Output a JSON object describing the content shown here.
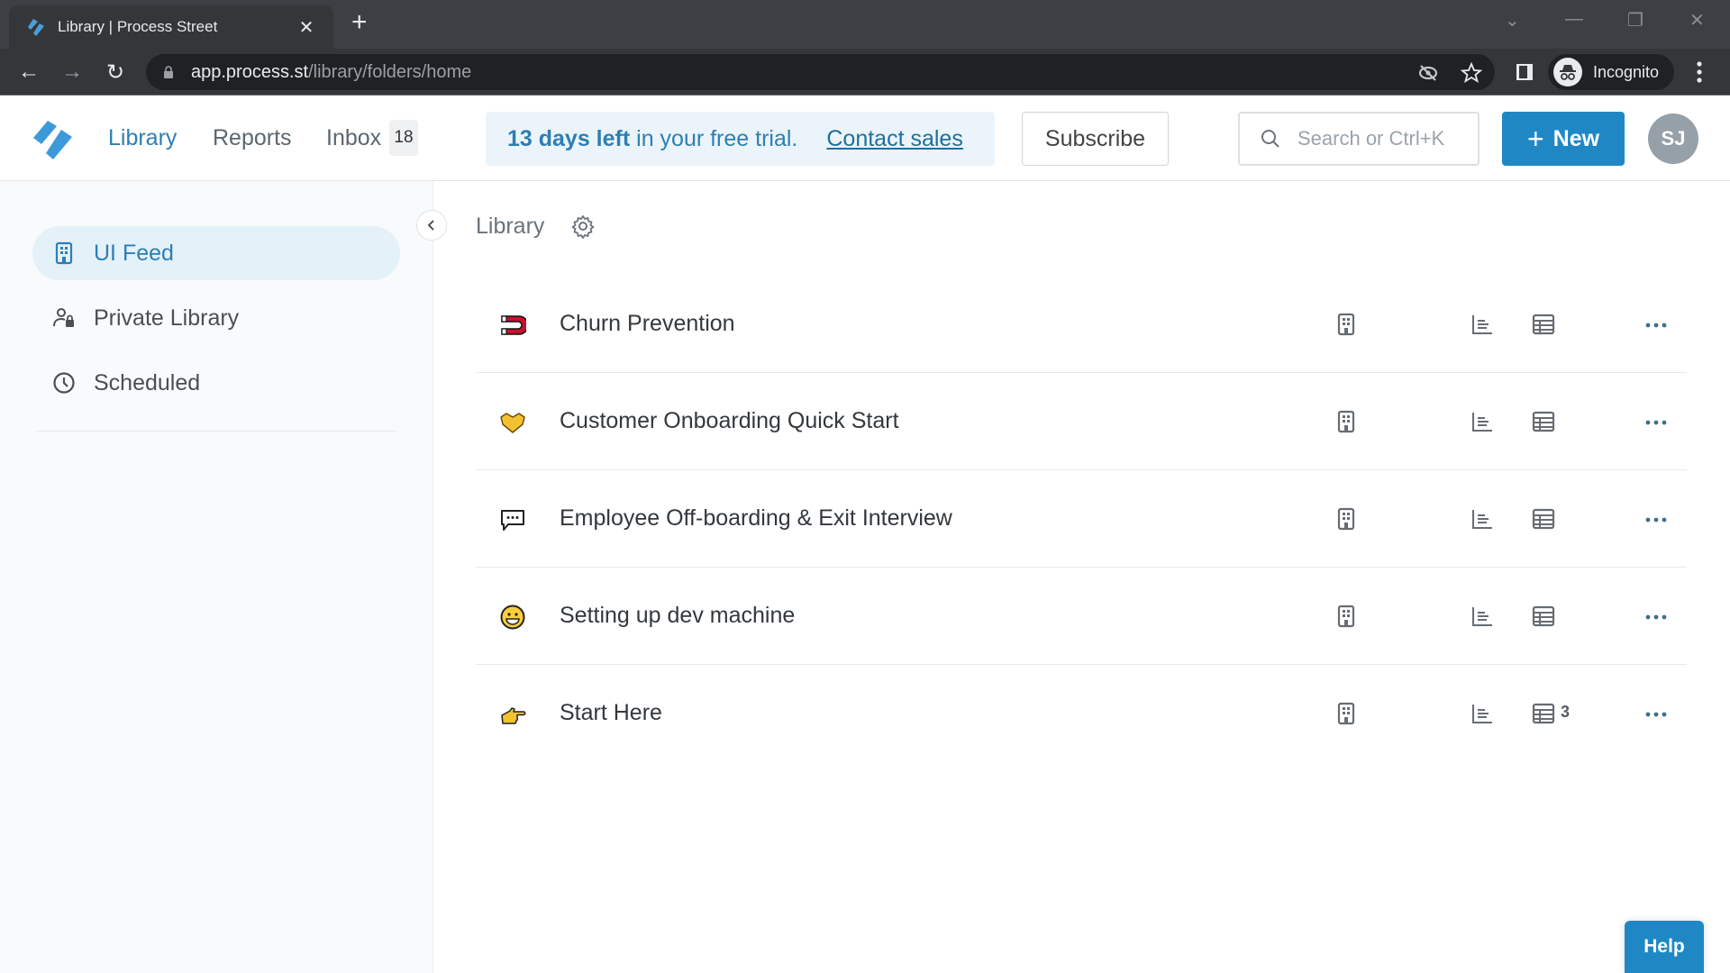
{
  "browser": {
    "tab_title": "Library | Process Street",
    "url_host": "app.process.st",
    "url_path": "/library/folders/home",
    "profile_label": "Incognito"
  },
  "header": {
    "nav": [
      {
        "label": "Library",
        "active": true
      },
      {
        "label": "Reports",
        "active": false
      },
      {
        "label": "Inbox",
        "active": false
      }
    ],
    "inbox_count": "18",
    "trial_bold": "13 days left",
    "trial_text": " in your free trial.",
    "contact_sales": "Contact sales",
    "subscribe": "Subscribe",
    "search_placeholder": "Search or Ctrl+K",
    "new_label": "New",
    "avatar_initials": "SJ",
    "brand_color": "#1f88c4"
  },
  "sidebar": {
    "items": [
      {
        "label": "UI Feed",
        "icon": "building-icon",
        "active": true
      },
      {
        "label": "Private Library",
        "icon": "user-lock-icon",
        "active": false
      },
      {
        "label": "Scheduled",
        "icon": "clock-icon",
        "active": false
      }
    ]
  },
  "main": {
    "breadcrumb": "Library",
    "rows": [
      {
        "title": "Churn Prevention",
        "emoji": "magnet",
        "table_count": ""
      },
      {
        "title": "Customer Onboarding Quick Start",
        "emoji": "handshake",
        "table_count": ""
      },
      {
        "title": "Employee Off-boarding & Exit Interview",
        "emoji": "speech-balloon",
        "table_count": ""
      },
      {
        "title": "Setting up dev machine",
        "emoji": "grinning-face",
        "table_count": ""
      },
      {
        "title": "Start Here",
        "emoji": "pointing-hand",
        "table_count": "3"
      }
    ]
  },
  "help_label": "Help"
}
